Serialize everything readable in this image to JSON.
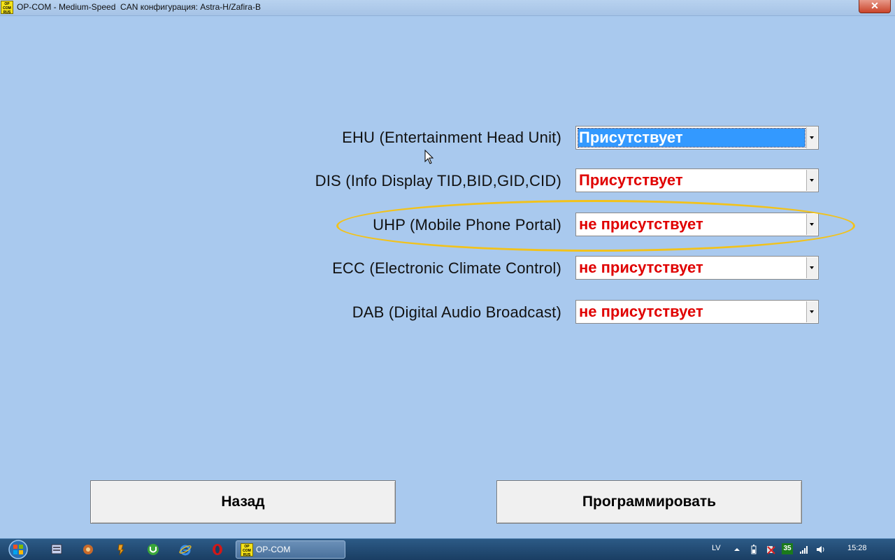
{
  "window": {
    "title": "OP-COM - Medium-Speed  CAN конфигурация: Astra-H/Zafira-B",
    "app_icon_text": [
      "OP",
      "COM",
      "RUS"
    ],
    "close_label": "✕"
  },
  "rows": [
    {
      "label": "EHU (Entertainment Head Unit)",
      "value": "Присутствует",
      "selected": true
    },
    {
      "label": "DIS (Info Display TID,BID,GID,CID)",
      "value": "Присутствует",
      "selected": false
    },
    {
      "label": "UHP (Mobile Phone Portal)",
      "value": "не присутствует",
      "selected": false,
      "highlighted": true
    },
    {
      "label": "ECC (Electronic Climate Control)",
      "value": "не присутствует",
      "selected": false
    },
    {
      "label": "DAB (Digital Audio Broadcast)",
      "value": "не присутствует",
      "selected": false
    }
  ],
  "buttons": {
    "back": "Назад",
    "program": "Программировать"
  },
  "taskbar": {
    "task_label": "OP-COM",
    "language": "LV",
    "badge": "35",
    "clock": "15:28"
  },
  "colors": {
    "background": "#a9c9ee",
    "value_text": "#e00000",
    "selection": "#3399ff",
    "highlight_ellipse": "#f2c21b"
  }
}
